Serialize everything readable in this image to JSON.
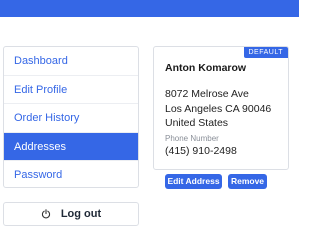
{
  "nav": {
    "items": [
      {
        "label": "Dashboard",
        "active": false
      },
      {
        "label": "Edit Profile",
        "active": false
      },
      {
        "label": "Order History",
        "active": false
      },
      {
        "label": "Addresses",
        "active": true
      },
      {
        "label": "Password",
        "active": false
      }
    ],
    "logout_label": "Log out",
    "logout_icon": "power-icon"
  },
  "address_card": {
    "badge": "DEFAULT",
    "name": "Anton Komarow",
    "street": "8072 Melrose Ave",
    "city_line": "Los Angeles CA 90046",
    "country": "United States",
    "phone_label": "Phone Number",
    "phone": "(415) 910-2498"
  },
  "actions": {
    "edit_label": "Edit Address",
    "remove_label": "Remove"
  },
  "colors": {
    "accent": "#3567e6",
    "border": "#dcdfe5"
  }
}
